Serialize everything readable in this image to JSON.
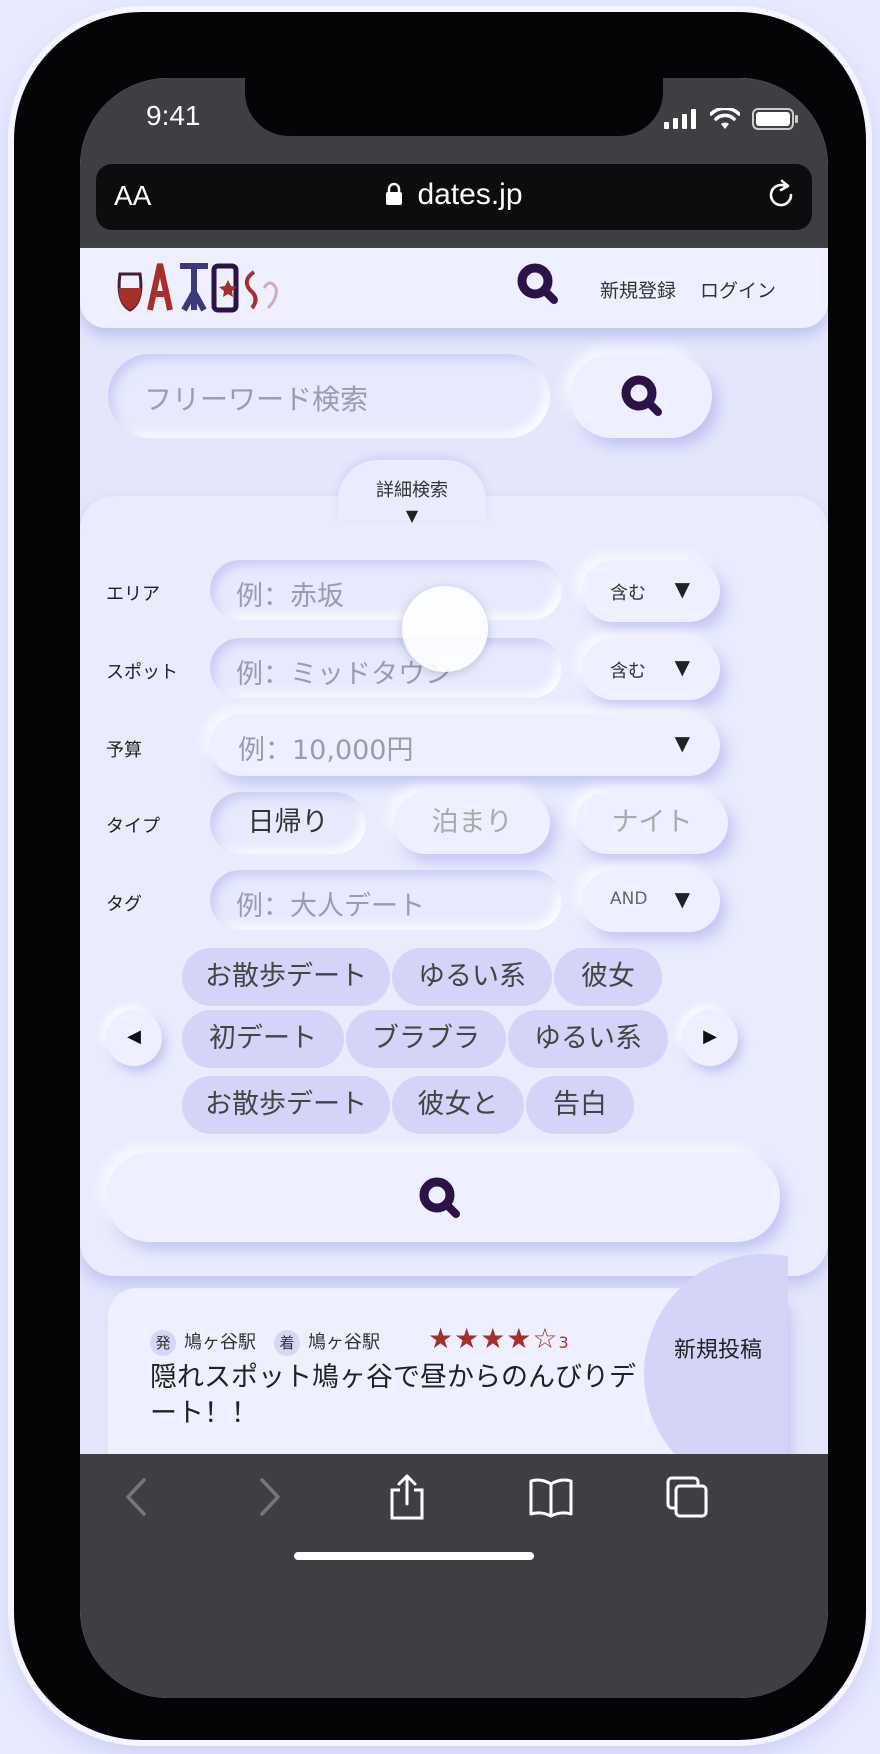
{
  "status_bar": {
    "time": "9:41"
  },
  "browser": {
    "text_size_label": "AA",
    "url": "dates.jp"
  },
  "header": {
    "logo_text": "DATES",
    "register_label": "新規登録",
    "login_label": "ログイン"
  },
  "search": {
    "freeword_placeholder": "フリーワード検索"
  },
  "advanced": {
    "tab_label": "詳細検索",
    "tab_arrow": "▼",
    "area": {
      "label": "エリア",
      "placeholder": "例：赤坂",
      "match": "含む"
    },
    "spot": {
      "label": "スポット",
      "placeholder": "例：ミッドタウン",
      "match": "含む"
    },
    "budget": {
      "label": "予算",
      "placeholder": "例：10,000円"
    },
    "type": {
      "label": "タイプ",
      "options": [
        "日帰り",
        "泊まり",
        "ナイト"
      ],
      "selected": "日帰り"
    },
    "tag": {
      "label": "タグ",
      "placeholder": "例：大人デート",
      "match": "AND"
    },
    "chevron": "▼",
    "tags": [
      [
        "お散歩デート",
        "ゆるい系",
        "彼女"
      ],
      [
        "初デート",
        "ブラブラ",
        "ゆるい系"
      ],
      [
        "お散歩デート",
        "彼女と",
        "告白"
      ]
    ],
    "prev_arrow": "◀",
    "next_arrow": "▶"
  },
  "post_card": {
    "depart_badge": "発",
    "depart_station": "鳩ヶ谷駅",
    "arrive_badge": "着",
    "arrive_station": "鳩ヶ谷駅",
    "stars": "★★★★☆",
    "rating_count": "3",
    "title": "隠れスポット鳩ヶ谷で昼からのんびりデート！！"
  },
  "new_post_label": "新規投稿",
  "colors": {
    "accent": "#2c1246",
    "star": "#a3302a",
    "tag_bg": "#d3d4f7"
  },
  "icons": [
    "signal-icon",
    "wifi-icon",
    "battery-icon",
    "lock-icon",
    "reload-icon",
    "search-icon",
    "back-icon",
    "forward-icon",
    "share-icon",
    "bookmarks-icon",
    "tabs-icon"
  ]
}
